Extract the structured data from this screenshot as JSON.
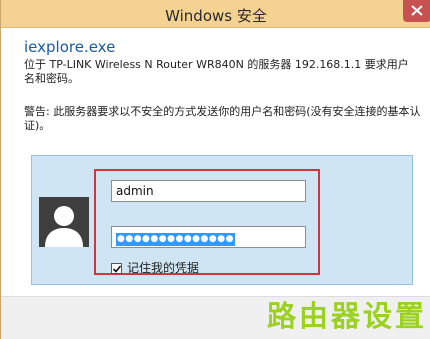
{
  "window": {
    "title": "Windows 安全"
  },
  "dialog": {
    "app_name": "iexplore.exe",
    "description": "位于 TP-LINK Wireless N Router WR840N 的服务器 192.168.1.1 要求用户名和密码。",
    "warning": "警告: 此服务器要求以不安全的方式发送你的用户名和密码(没有安全连接的基本认证)。"
  },
  "credentials": {
    "username_value": "admin",
    "password_masked": "●●●●●●●●●●●●●●",
    "remember_label": "记住我的凭据",
    "remember_checked": true
  },
  "watermark": {
    "text": "路由器设置"
  },
  "colors": {
    "titlebar": "#f4d291",
    "close_button": "#c75050",
    "app_name": "#1a5aa6",
    "panel": "#cfe5f3",
    "highlight_box": "#d8323c",
    "selection": "#3399ff",
    "watermark": "#9ad21f"
  },
  "icons": {
    "close": "close-icon",
    "avatar": "user-avatar-icon",
    "checkbox": "checkmark-icon"
  }
}
